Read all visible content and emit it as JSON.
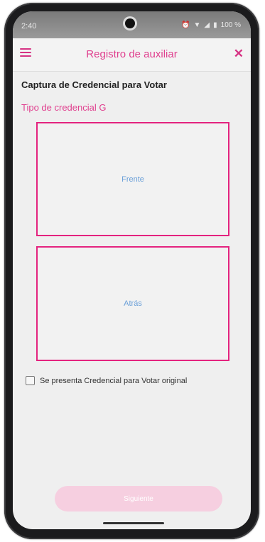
{
  "status_bar": {
    "time": "2:40",
    "icons": [
      "alarm-icon",
      "wifi-icon",
      "signal-icon",
      "battery-icon"
    ],
    "battery": "100 %"
  },
  "app_bar": {
    "title": "Registro de auxiliar",
    "menu_icon": "hamburger-menu-icon",
    "close_icon": "close-icon",
    "accent_color": "#e0408f"
  },
  "content": {
    "section_title": "Captura de Credencial para Votar",
    "credential_type": "Tipo de credencial G",
    "front_label": "Frente",
    "back_label": "Atrás",
    "original_checkbox_label": "Se presenta Credencial para Votar original",
    "original_checkbox_checked": false
  },
  "footer": {
    "continue_label": "Siguiente"
  }
}
